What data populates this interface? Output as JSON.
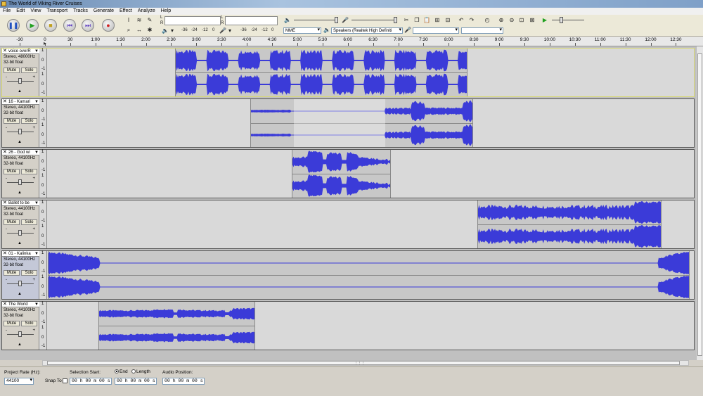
{
  "window": {
    "title": "The World of Viking River Cruises"
  },
  "menu": [
    "File",
    "Edit",
    "View",
    "Transport",
    "Tracks",
    "Generate",
    "Effect",
    "Analyze",
    "Help"
  ],
  "meters": {
    "rec_scale": [
      "-36",
      "-24",
      "-12",
      "0"
    ],
    "play_scale": [
      "-36",
      "-24",
      "-12",
      "0"
    ],
    "lr": [
      "L",
      "R"
    ]
  },
  "device": {
    "host": "MME",
    "output": "Speakers (Realtek High Definiti",
    "input": "",
    "channels": ""
  },
  "timeline": {
    "labels": [
      "-30",
      "0",
      "30",
      "1:00",
      "1:30",
      "2:00",
      "2:30",
      "3:00",
      "3:30",
      "4:00",
      "4:30",
      "5:00",
      "5:30",
      "6:00",
      "6:30",
      "7:00",
      "7:30",
      "8:00",
      "8:30",
      "9:00",
      "9:30",
      "10:00",
      "10:30",
      "11:00",
      "11:30",
      "12:00",
      "12:30"
    ]
  },
  "tracks": [
    {
      "name": "voice overR",
      "rate": "Stereo, 48000Hz",
      "format": "32-bit float",
      "mute": "Mute",
      "solo": "Solo"
    },
    {
      "name": "16 - Kamari",
      "rate": "Stereo, 44100Hz",
      "format": "32-bit float",
      "mute": "Mute",
      "solo": "Solo"
    },
    {
      "name": "26 - God wi",
      "rate": "Stereo, 44100Hz",
      "format": "32-bit float",
      "mute": "Mute",
      "solo": "Solo"
    },
    {
      "name": "Ballet to be",
      "rate": "Stereo, 44100Hz",
      "format": "32-bit float",
      "mute": "Mute",
      "solo": "Solo"
    },
    {
      "name": "01 - Kalinka",
      "rate": "Stereo, 44100Hz",
      "format": "32-bit float",
      "mute": "Mute",
      "solo": "Solo"
    },
    {
      "name": "The World",
      "rate": "Stereo, 44100Hz",
      "format": "32-bit float",
      "mute": "Mute",
      "solo": "Solo"
    }
  ],
  "scale": {
    "top": "1",
    "mid": "0",
    "bot": "-1"
  },
  "status": {
    "project_rate_label": "Project Rate (Hz):",
    "project_rate": "44100",
    "snap_label": "Snap To",
    "selection_start_label": "Selection Start:",
    "end_label": "End",
    "length_label": "Length",
    "audio_position_label": "Audio Position:",
    "sel_start": "00 h 00 m 00 s",
    "sel_end": "00 h 00 m 00 s",
    "audio_pos": "00 h 00 m 00 s"
  },
  "colors": {
    "waveform": "#3b3bd8",
    "clip_bg": "#c8c8c8",
    "track_bg": "#d9d9d9"
  }
}
